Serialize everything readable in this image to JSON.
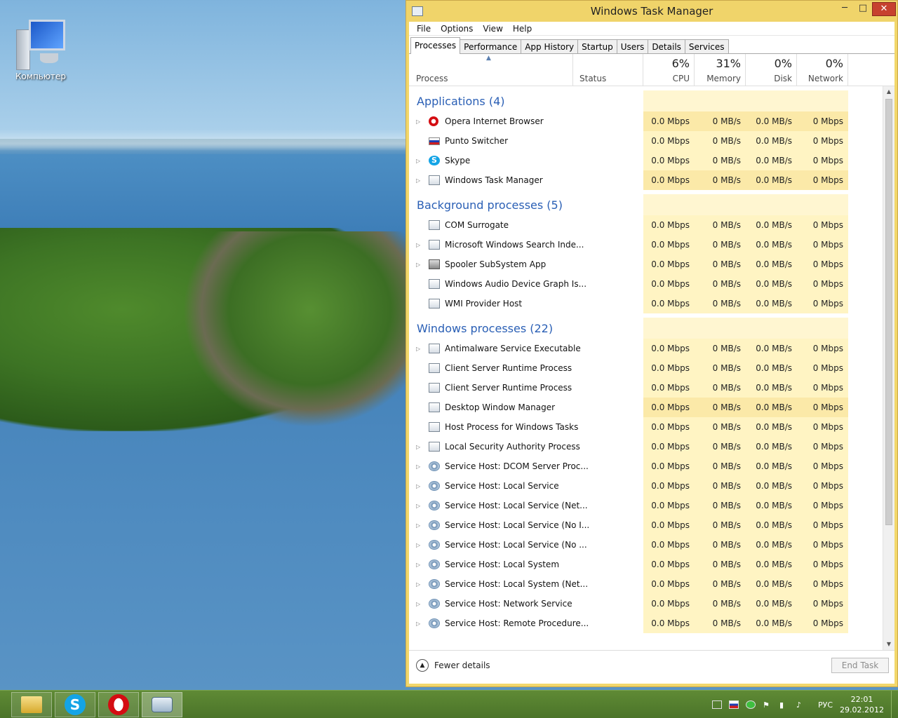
{
  "desktop": {
    "icon_label": "Компьютер"
  },
  "window": {
    "title": "Windows Task Manager",
    "controls": {
      "minimize": "─",
      "maximize": "□",
      "close": "✕"
    }
  },
  "menu": [
    "File",
    "Options",
    "View",
    "Help"
  ],
  "tabs": [
    "Processes",
    "Performance",
    "App History",
    "Startup",
    "Users",
    "Details",
    "Services"
  ],
  "header": {
    "process": "Process",
    "status": "Status",
    "cpu": {
      "pct": "6%",
      "label": "CPU"
    },
    "memory": {
      "pct": "31%",
      "label": "Memory"
    },
    "disk": {
      "pct": "0%",
      "label": "Disk"
    },
    "network": {
      "pct": "0%",
      "label": "Network"
    }
  },
  "groups": [
    {
      "title": "Applications (4)",
      "rows": [
        {
          "name": "Opera Internet Browser",
          "icon": "opera-icon",
          "expand": true,
          "cpu": "0.0 Mbps",
          "mem": "0 MB/s",
          "disk": "0.0 MB/s",
          "net": "0 Mbps",
          "hi": true
        },
        {
          "name": "Punto Switcher",
          "icon": "flag-icon",
          "expand": false,
          "cpu": "0.0 Mbps",
          "mem": "0 MB/s",
          "disk": "0.0 MB/s",
          "net": "0 Mbps",
          "hi": false
        },
        {
          "name": "Skype",
          "icon": "skype-icon",
          "expand": true,
          "cpu": "0.0 Mbps",
          "mem": "0 MB/s",
          "disk": "0.0 MB/s",
          "net": "0 Mbps",
          "hi": false
        },
        {
          "name": "Windows Task Manager",
          "icon": "task-manager-icon",
          "expand": true,
          "cpu": "0.0 Mbps",
          "mem": "0 MB/s",
          "disk": "0.0 MB/s",
          "net": "0 Mbps",
          "hi": true
        }
      ]
    },
    {
      "title": "Background processes (5)",
      "rows": [
        {
          "name": "COM Surrogate",
          "icon": "window-icon",
          "expand": false,
          "cpu": "0.0 Mbps",
          "mem": "0 MB/s",
          "disk": "0.0 MB/s",
          "net": "0 Mbps",
          "hi": false
        },
        {
          "name": "Microsoft Windows Search Inde...",
          "icon": "search-indexer-icon",
          "expand": true,
          "cpu": "0.0 Mbps",
          "mem": "0 MB/s",
          "disk": "0.0 MB/s",
          "net": "0 Mbps",
          "hi": false
        },
        {
          "name": "Spooler SubSystem App",
          "icon": "printer-icon",
          "expand": true,
          "cpu": "0.0 Mbps",
          "mem": "0 MB/s",
          "disk": "0.0 MB/s",
          "net": "0 Mbps",
          "hi": false
        },
        {
          "name": "Windows Audio Device Graph Is...",
          "icon": "window-icon",
          "expand": false,
          "cpu": "0.0 Mbps",
          "mem": "0 MB/s",
          "disk": "0.0 MB/s",
          "net": "0 Mbps",
          "hi": false
        },
        {
          "name": "WMI Provider Host",
          "icon": "window-icon",
          "expand": false,
          "cpu": "0.0 Mbps",
          "mem": "0 MB/s",
          "disk": "0.0 MB/s",
          "net": "0 Mbps",
          "hi": false
        }
      ]
    },
    {
      "title": "Windows processes (22)",
      "rows": [
        {
          "name": "Antimalware Service Executable",
          "icon": "window-icon",
          "expand": true,
          "cpu": "0.0 Mbps",
          "mem": "0 MB/s",
          "disk": "0.0 MB/s",
          "net": "0 Mbps",
          "hi": false
        },
        {
          "name": "Client Server Runtime Process",
          "icon": "window-icon",
          "expand": false,
          "cpu": "0.0 Mbps",
          "mem": "0 MB/s",
          "disk": "0.0 MB/s",
          "net": "0 Mbps",
          "hi": false
        },
        {
          "name": "Client Server Runtime Process",
          "icon": "window-icon",
          "expand": false,
          "cpu": "0.0 Mbps",
          "mem": "0 MB/s",
          "disk": "0.0 MB/s",
          "net": "0 Mbps",
          "hi": false
        },
        {
          "name": "Desktop Window Manager",
          "icon": "window-icon",
          "expand": false,
          "cpu": "0.0 Mbps",
          "mem": "0 MB/s",
          "disk": "0.0 MB/s",
          "net": "0 Mbps",
          "hi": true
        },
        {
          "name": "Host Process for Windows Tasks",
          "icon": "window-icon",
          "expand": false,
          "cpu": "0.0 Mbps",
          "mem": "0 MB/s",
          "disk": "0.0 MB/s",
          "net": "0 Mbps",
          "hi": false
        },
        {
          "name": "Local Security Authority Process",
          "icon": "window-icon",
          "expand": true,
          "cpu": "0.0 Mbps",
          "mem": "0 MB/s",
          "disk": "0.0 MB/s",
          "net": "0 Mbps",
          "hi": false
        },
        {
          "name": "Service Host: DCOM Server Proc...",
          "icon": "gear-icon",
          "expand": true,
          "cpu": "0.0 Mbps",
          "mem": "0 MB/s",
          "disk": "0.0 MB/s",
          "net": "0 Mbps",
          "hi": false
        },
        {
          "name": "Service Host: Local Service",
          "icon": "gear-icon",
          "expand": true,
          "cpu": "0.0 Mbps",
          "mem": "0 MB/s",
          "disk": "0.0 MB/s",
          "net": "0 Mbps",
          "hi": false
        },
        {
          "name": "Service Host: Local Service (Net...",
          "icon": "gear-icon",
          "expand": true,
          "cpu": "0.0 Mbps",
          "mem": "0 MB/s",
          "disk": "0.0 MB/s",
          "net": "0 Mbps",
          "hi": false
        },
        {
          "name": "Service Host: Local Service (No I...",
          "icon": "gear-icon",
          "expand": true,
          "cpu": "0.0 Mbps",
          "mem": "0 MB/s",
          "disk": "0.0 MB/s",
          "net": "0 Mbps",
          "hi": false
        },
        {
          "name": "Service Host: Local Service (No ...",
          "icon": "gear-icon",
          "expand": true,
          "cpu": "0.0 Mbps",
          "mem": "0 MB/s",
          "disk": "0.0 MB/s",
          "net": "0 Mbps",
          "hi": false
        },
        {
          "name": "Service Host: Local System",
          "icon": "gear-icon",
          "expand": true,
          "cpu": "0.0 Mbps",
          "mem": "0 MB/s",
          "disk": "0.0 MB/s",
          "net": "0 Mbps",
          "hi": false
        },
        {
          "name": "Service Host: Local System (Net...",
          "icon": "gear-icon",
          "expand": true,
          "cpu": "0.0 Mbps",
          "mem": "0 MB/s",
          "disk": "0.0 MB/s",
          "net": "0 Mbps",
          "hi": false
        },
        {
          "name": "Service Host: Network Service",
          "icon": "gear-icon",
          "expand": true,
          "cpu": "0.0 Mbps",
          "mem": "0 MB/s",
          "disk": "0.0 MB/s",
          "net": "0 Mbps",
          "hi": false
        },
        {
          "name": "Service Host: Remote Procedure...",
          "icon": "gear-icon",
          "expand": true,
          "cpu": "0.0 Mbps",
          "mem": "0 MB/s",
          "disk": "0.0 MB/s",
          "net": "0 Mbps",
          "hi": false
        }
      ]
    }
  ],
  "footer": {
    "fewer_details": "Fewer details",
    "end_task": "End Task"
  },
  "taskbar": {
    "buttons": [
      "file-explorer-icon",
      "skype-icon",
      "opera-icon",
      "task-manager-icon"
    ],
    "lang": "РУС",
    "time": "22:01",
    "date": "29.02.2012"
  }
}
